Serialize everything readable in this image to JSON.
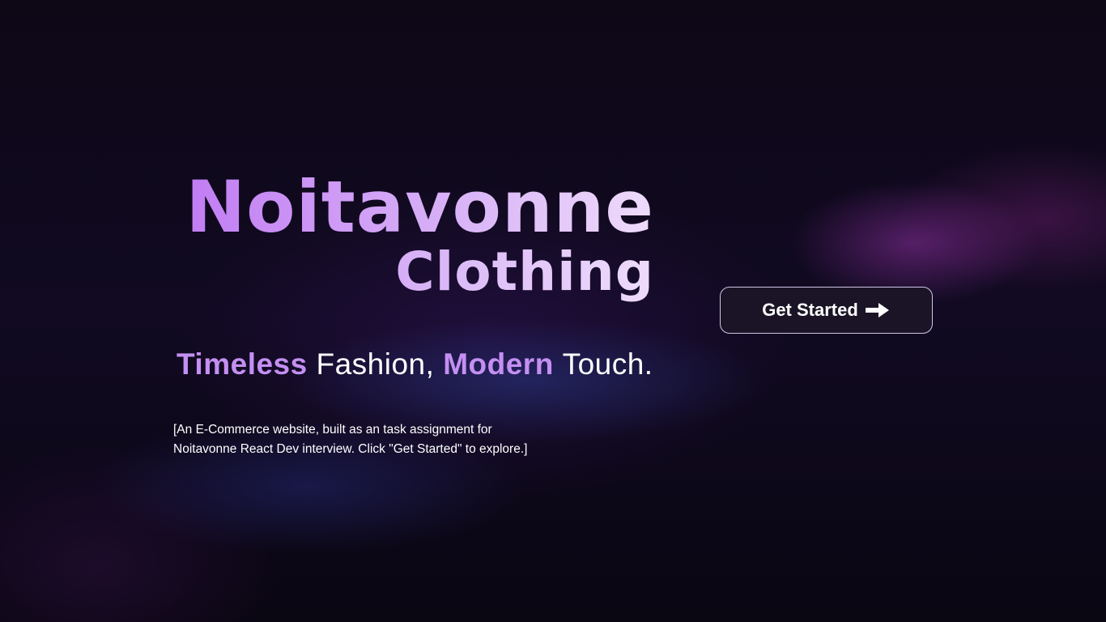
{
  "hero": {
    "brand_name": "Noitavonne",
    "brand_sub": "Clothing",
    "tagline": {
      "word1": "Timeless",
      "word2": "Fashion,",
      "word3": "Modern",
      "word4": "Touch."
    },
    "description_line1": "[An E-Commerce website, built as an task assignment for",
    "description_line2": "Noitavonne React Dev interview. Click \"Get Started\" to explore.]",
    "cta_label": "Get Started",
    "cta_icon": "arrow-right-icon"
  },
  "colors": {
    "background": "#0b0614",
    "accent": "#c48ff2",
    "button_bg": "#1a1426",
    "button_border": "#cfc6e6"
  }
}
